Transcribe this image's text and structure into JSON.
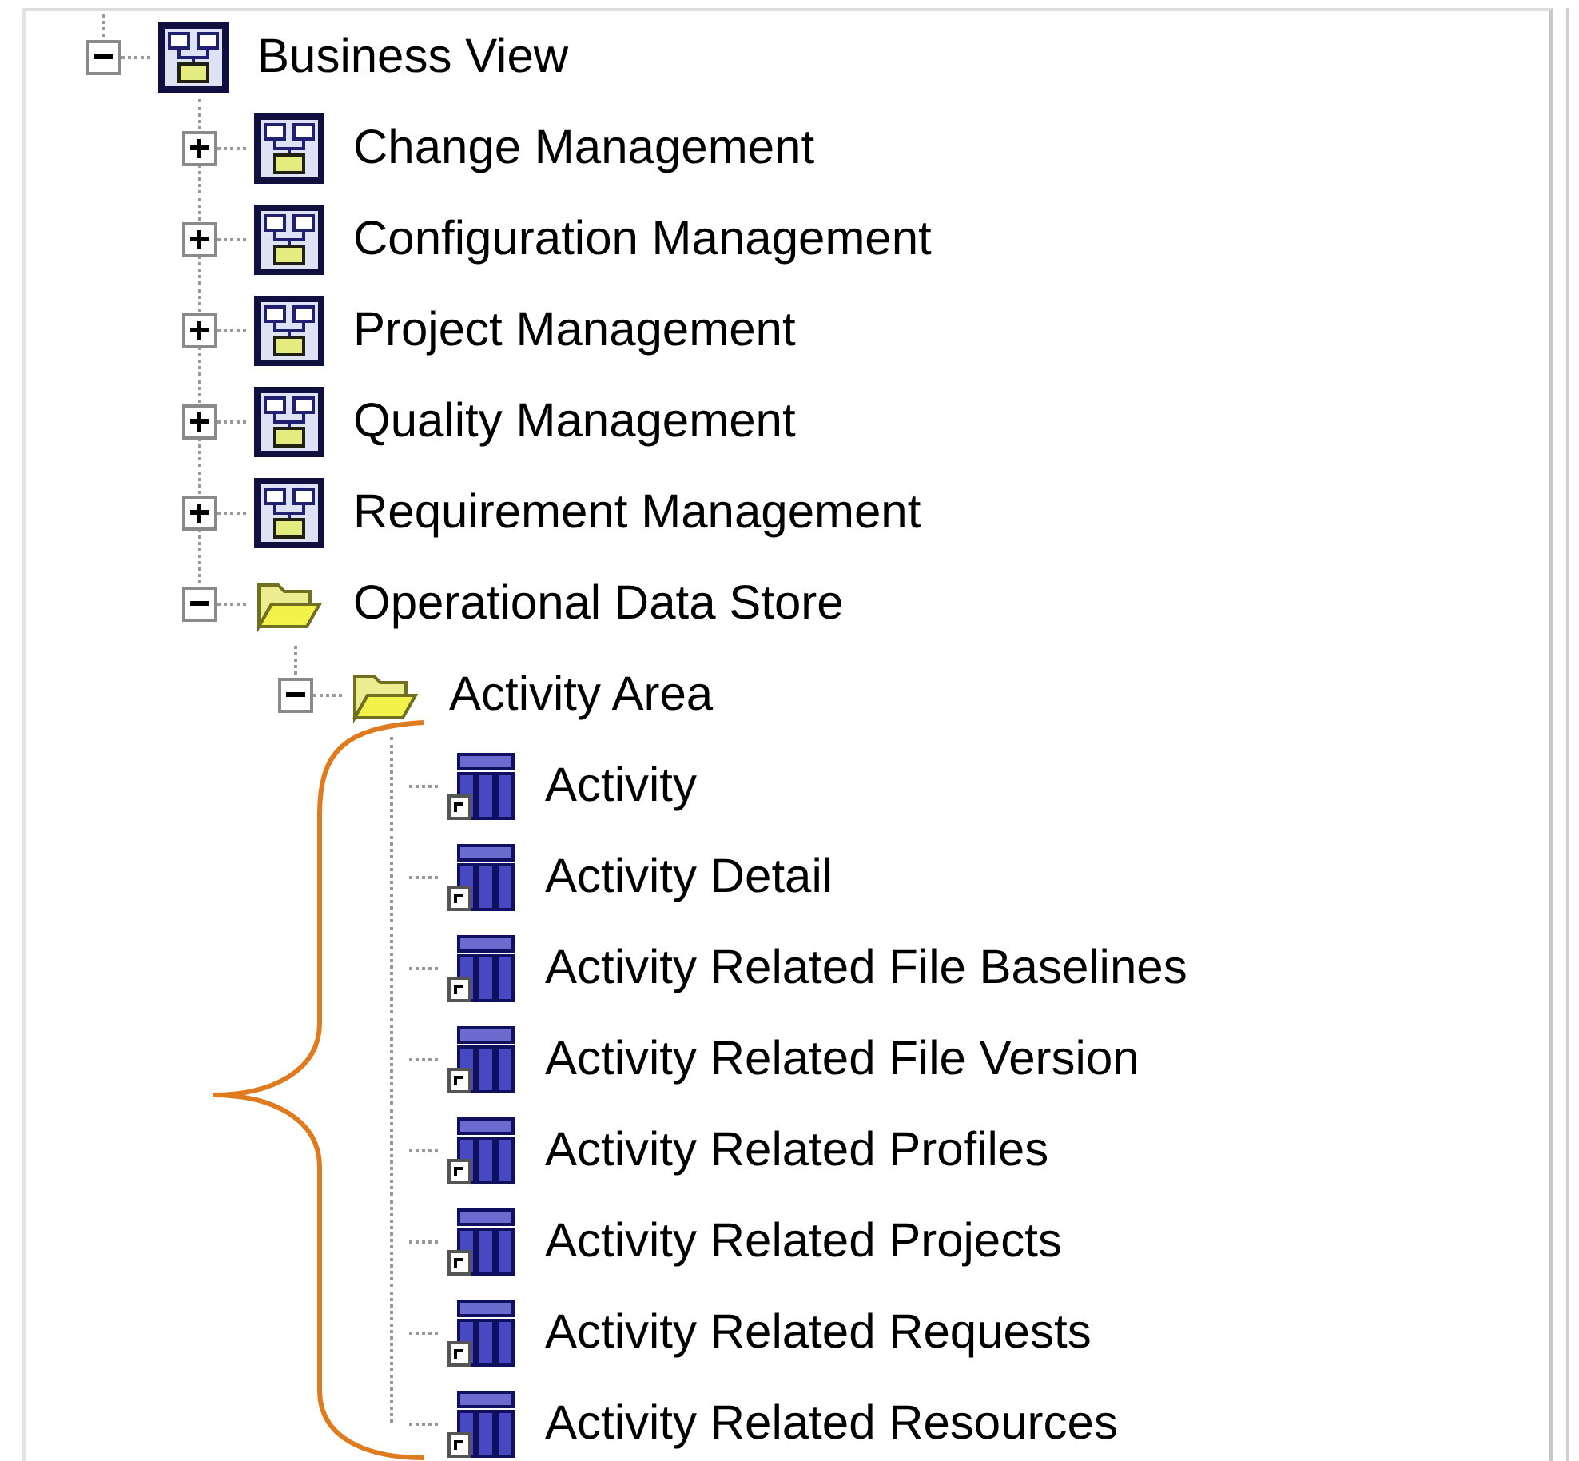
{
  "tree": [
    {
      "label": "Business View",
      "kind": "diagram",
      "expanded": true,
      "children": [
        {
          "label": "Change Management",
          "kind": "diagram",
          "expanded": false
        },
        {
          "label": "Configuration Management",
          "kind": "diagram",
          "expanded": false
        },
        {
          "label": "Project Management",
          "kind": "diagram",
          "expanded": false
        },
        {
          "label": "Quality Management",
          "kind": "diagram",
          "expanded": false
        },
        {
          "label": "Requirement Management",
          "kind": "diagram",
          "expanded": false
        },
        {
          "label": "Operational Data Store",
          "kind": "folder",
          "expanded": true,
          "children": [
            {
              "label": "Activity Area",
              "kind": "folder",
              "expanded": true,
              "children": [
                {
                  "label": "Activity",
                  "kind": "table"
                },
                {
                  "label": "Activity Detail",
                  "kind": "table"
                },
                {
                  "label": "Activity Related File Baselines",
                  "kind": "table"
                },
                {
                  "label": "Activity Related File Version",
                  "kind": "table"
                },
                {
                  "label": "Activity Related Profiles",
                  "kind": "table"
                },
                {
                  "label": "Activity Related Projects",
                  "kind": "table"
                },
                {
                  "label": "Activity Related Requests",
                  "kind": "table"
                },
                {
                  "label": "Activity Related Resources",
                  "kind": "table"
                }
              ]
            }
          ]
        }
      ]
    }
  ]
}
